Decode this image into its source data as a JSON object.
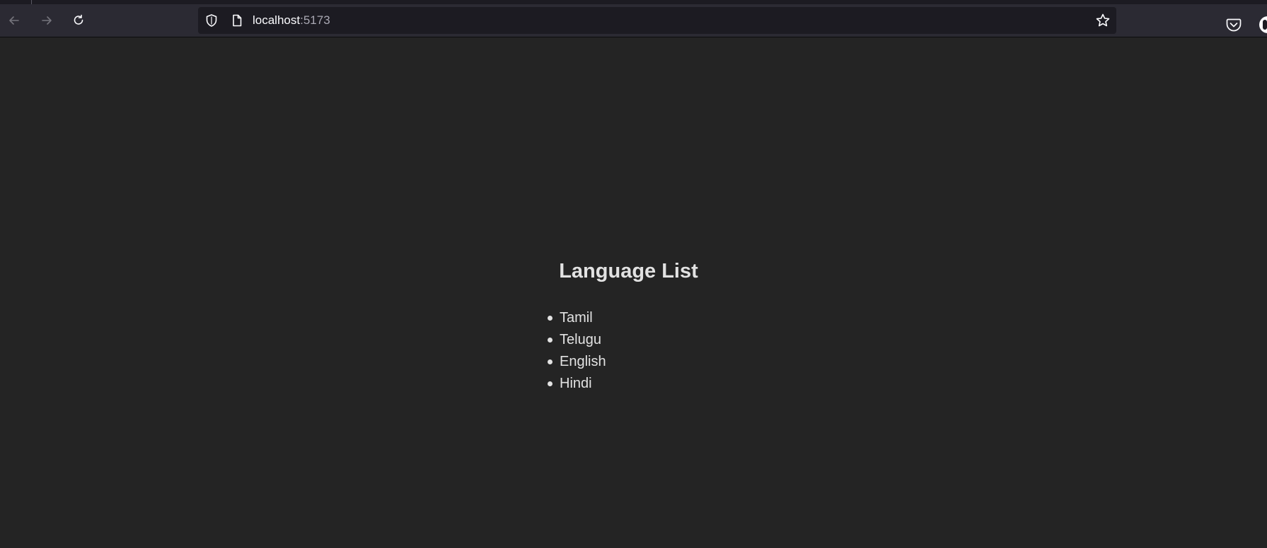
{
  "browser": {
    "url_host": "localhost",
    "url_port": ":5173",
    "icons": {
      "back": "arrow-left-icon",
      "forward": "arrow-right-icon",
      "reload": "reload-icon",
      "shield": "shield-icon",
      "page": "page-icon",
      "bookmark": "star-icon",
      "pocket": "pocket-icon",
      "account": "account-avatar"
    },
    "colors": {
      "toolbar": "#2b2a33",
      "urlbar": "#1c1b22",
      "content_bg": "#242424"
    }
  },
  "page": {
    "title": "Language List",
    "languages": [
      "Tamil",
      "Telugu",
      "English",
      "Hindi"
    ]
  }
}
